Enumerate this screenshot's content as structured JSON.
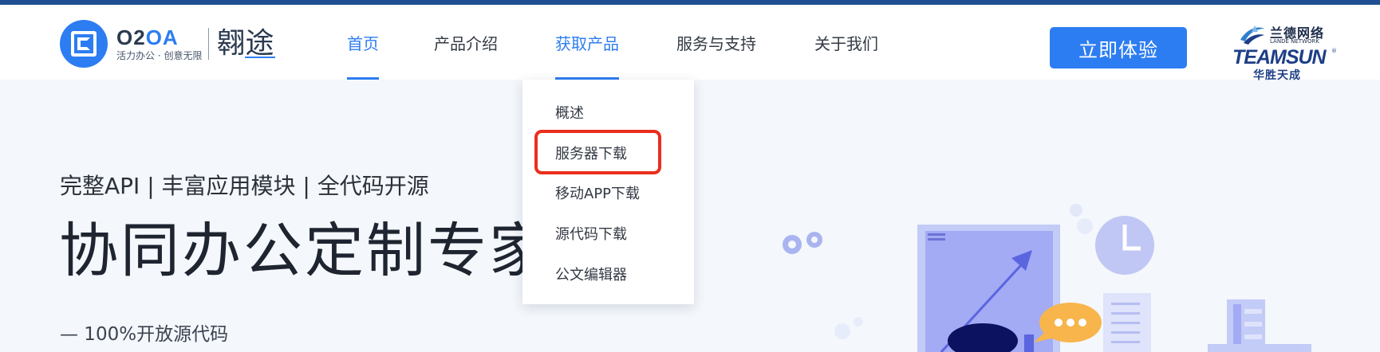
{
  "logo": {
    "brand_part1": "O2",
    "brand_part2": "OA",
    "slogan": "活力办公 · 创意无限",
    "product_name": "翱途"
  },
  "nav": {
    "items": [
      {
        "label": "首页",
        "active": true
      },
      {
        "label": "产品介绍",
        "active": false
      },
      {
        "label": "获取产品",
        "active": true
      },
      {
        "label": "服务与支持",
        "active": false
      },
      {
        "label": "关于我们",
        "active": false
      }
    ]
  },
  "cta": {
    "label": "立即体验"
  },
  "partner": {
    "cn_name": "兰德网络",
    "en_small": "LANDE NETWORK",
    "brand": "TEAMSUN",
    "reg_mark": "®",
    "sub": "华胜天成"
  },
  "dropdown": {
    "items": [
      {
        "label": "概述"
      },
      {
        "label": "服务器下载",
        "highlighted": true
      },
      {
        "label": "移动APP下载"
      },
      {
        "label": "源代码下载"
      },
      {
        "label": "公文编辑器"
      }
    ]
  },
  "hero": {
    "subtitle": "完整API | 丰富应用模块 | 全代码开源",
    "title": "协同办公定制专家",
    "tagline": "— 100%开放源代码"
  },
  "colors": {
    "accent": "#2d7df2",
    "top_strip": "#1f4f91",
    "highlight": "#ea2e1d",
    "background": "#f4f7fb"
  }
}
